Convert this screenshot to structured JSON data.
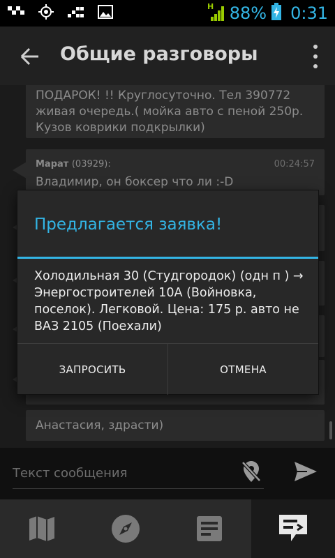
{
  "status_bar": {
    "network_type": "H",
    "battery_percent": "88%",
    "time": "0:31",
    "icons": [
      "taxi-icon",
      "gps-icon",
      "signal-dots-icon",
      "image-icon",
      "network-signal-icon",
      "battery-charging-icon"
    ]
  },
  "action_bar": {
    "title": "Общие разговоры",
    "icons": [
      "back-arrow-icon",
      "overflow-menu-icon"
    ]
  },
  "messages": [
    {
      "text": "ПОДАРОК! !! Круглосуточно. Тел 390772 живая очередь.( мойка авто с пеной 250р. Кузов коврики подкрылки)"
    },
    {
      "sender": "Марат",
      "sender_id": "(03929):",
      "time": "00:24:57",
      "text": "Владимир, он боксер что ли :-D"
    },
    {
      "text": "Анастасия, здрасти)"
    }
  ],
  "dialog": {
    "title": "Предлагается заявка!",
    "message": "Холодильная 30 (Студгородок) (одн п ) → Энергостроителей 10А (Войновка, поселок). Легковой. Цена: 175 р. авто не ВАЗ 2105   (Поехали)",
    "positive_button": "ЗАПРОСИТЬ",
    "negative_button": "ОТМЕНА"
  },
  "composer": {
    "placeholder": "Текст сообщения",
    "value": "",
    "icons": [
      "location-off-icon",
      "send-icon"
    ]
  },
  "bottom_nav": {
    "tabs": [
      "map-icon",
      "compass-icon",
      "orders-list-icon",
      "chat-icon"
    ],
    "active_tab": "chat-icon"
  },
  "colors": {
    "accent": "#33b5e5",
    "status_green": "#99cc00"
  }
}
